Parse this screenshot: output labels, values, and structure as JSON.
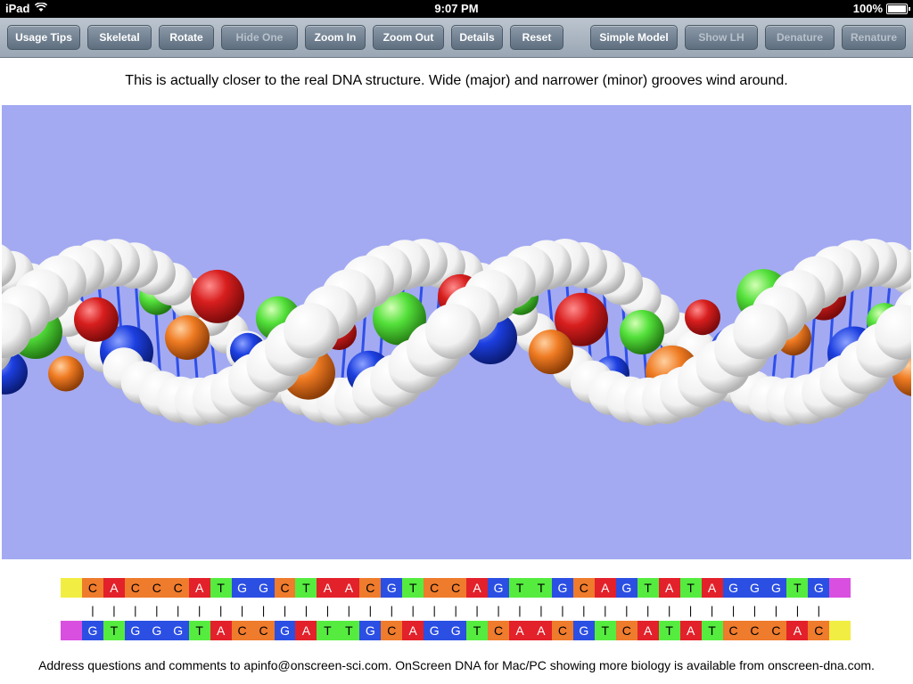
{
  "status": {
    "device": "iPad",
    "time": "9:07 PM",
    "battery": "100%"
  },
  "toolbar": {
    "buttons": [
      {
        "label": "Usage Tips",
        "enabled": true
      },
      {
        "label": "Skeletal",
        "enabled": true
      },
      {
        "label": "Rotate",
        "enabled": true
      },
      {
        "label": "Hide One",
        "enabled": false
      },
      {
        "label": "Zoom In",
        "enabled": true
      },
      {
        "label": "Zoom Out",
        "enabled": true
      },
      {
        "label": "Details",
        "enabled": true
      },
      {
        "label": "Reset",
        "enabled": true
      },
      {
        "label": "Simple Model",
        "enabled": true
      },
      {
        "label": "Show LH",
        "enabled": false
      },
      {
        "label": "Denature",
        "enabled": false
      },
      {
        "label": "Renature",
        "enabled": false
      }
    ]
  },
  "caption": "This is actually closer to the real DNA structure. Wide (major) and narrower (minor) grooves wind around.",
  "sequence": {
    "top": "CACCCATGGCTAACGTCCAGTTGCAGTATAGGGTG",
    "bottom": "GTGGGTACCGATTGCAGGTCAACGTCATATCCCAC",
    "bond": "|",
    "colors": {
      "A": "#e3212a",
      "C": "#ef7b2c",
      "G": "#2b4fe3",
      "T": "#55ec3f",
      "end5": "#f2ed42",
      "end3": "#d94fe0"
    },
    "text_colors": {
      "A": "#ffffff",
      "C": "#000000",
      "G": "#ffffff",
      "T": "#000000"
    }
  },
  "viewer": {
    "background": "#a3aaf2"
  },
  "footer": "Address questions and comments to apinfo@onscreen-sci.com. OnScreen DNA for Mac/PC showing more biology is available from onscreen-dna.com."
}
